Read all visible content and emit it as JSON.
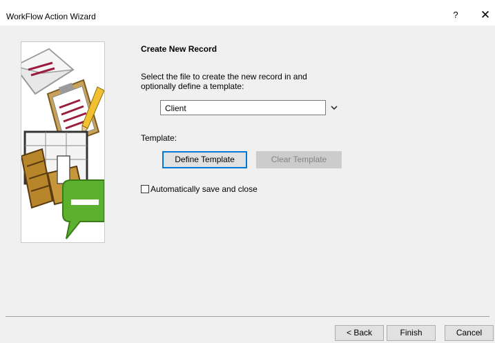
{
  "window": {
    "title": "WorkFlow Action Wizard",
    "help_label": "?",
    "close_label": "✕"
  },
  "page": {
    "heading": "Create New Record",
    "instruction": "Select the file to create the new record in and optionally define a template:",
    "file_select": {
      "value": "Client"
    },
    "template_label": "Template:",
    "define_template_label": "Define Template",
    "clear_template_label": "Clear Template",
    "auto_save": {
      "label": "Automatically save and close",
      "checked": false
    }
  },
  "footer": {
    "back_label": "< Back",
    "finish_label": "Finish",
    "cancel_label": "Cancel"
  },
  "colors": {
    "focus_border": "#0078d7",
    "disabled_button": "#cccccc",
    "dialog_bg": "#f0f0f0"
  },
  "icons": [
    "help-icon",
    "close-icon",
    "chevron-down-icon",
    "wizard-illustration"
  ]
}
